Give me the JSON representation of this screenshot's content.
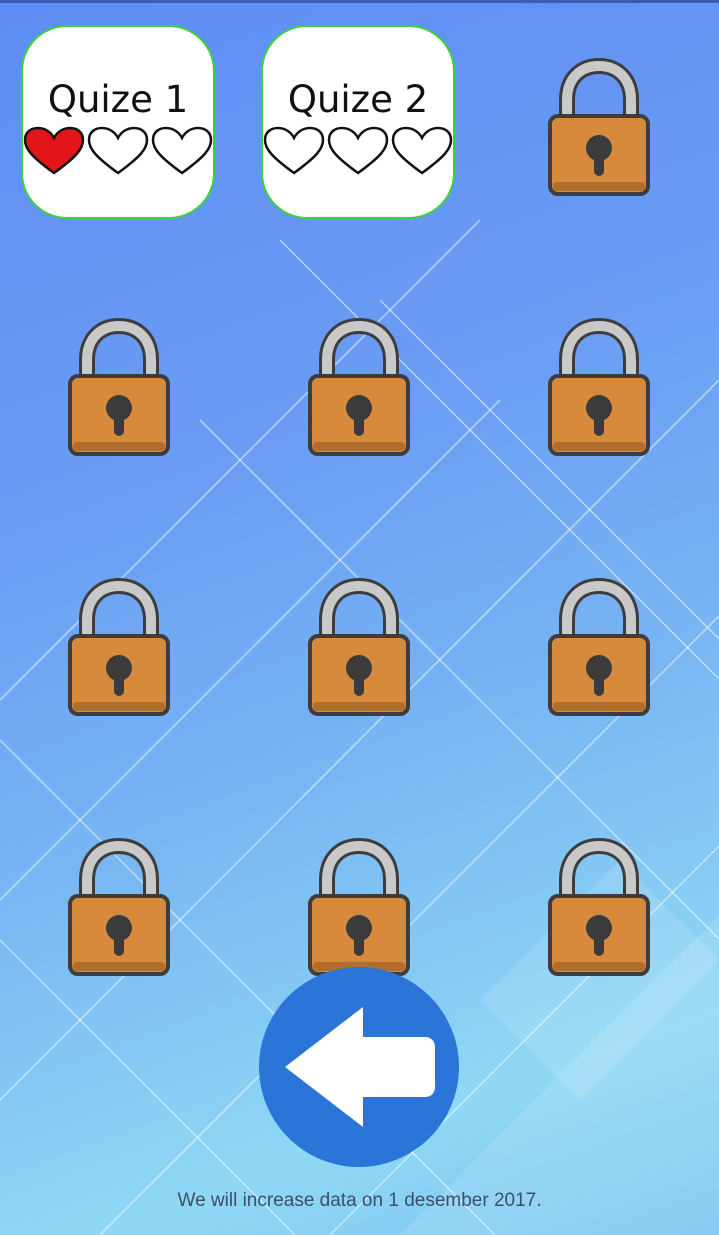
{
  "quizzes": [
    {
      "title": "Quize 1",
      "hearts": [
        true,
        false,
        false
      ],
      "unlocked": true
    },
    {
      "title": "Quize 2",
      "hearts": [
        false,
        false,
        false
      ],
      "unlocked": true
    }
  ],
  "locked_levels_count": 10,
  "colors": {
    "card_border": "#3bd23b",
    "heart_filled": "#e4141b",
    "lock_body": "#d88a3c",
    "lock_shackle": "#c9c9c9",
    "back_button": "#2b74d8"
  },
  "icons": {
    "lock": "padlock-icon",
    "heart": "heart-icon",
    "back": "back-arrow-icon"
  },
  "footer": {
    "text": "We will increase data on 1 desember 2017."
  }
}
